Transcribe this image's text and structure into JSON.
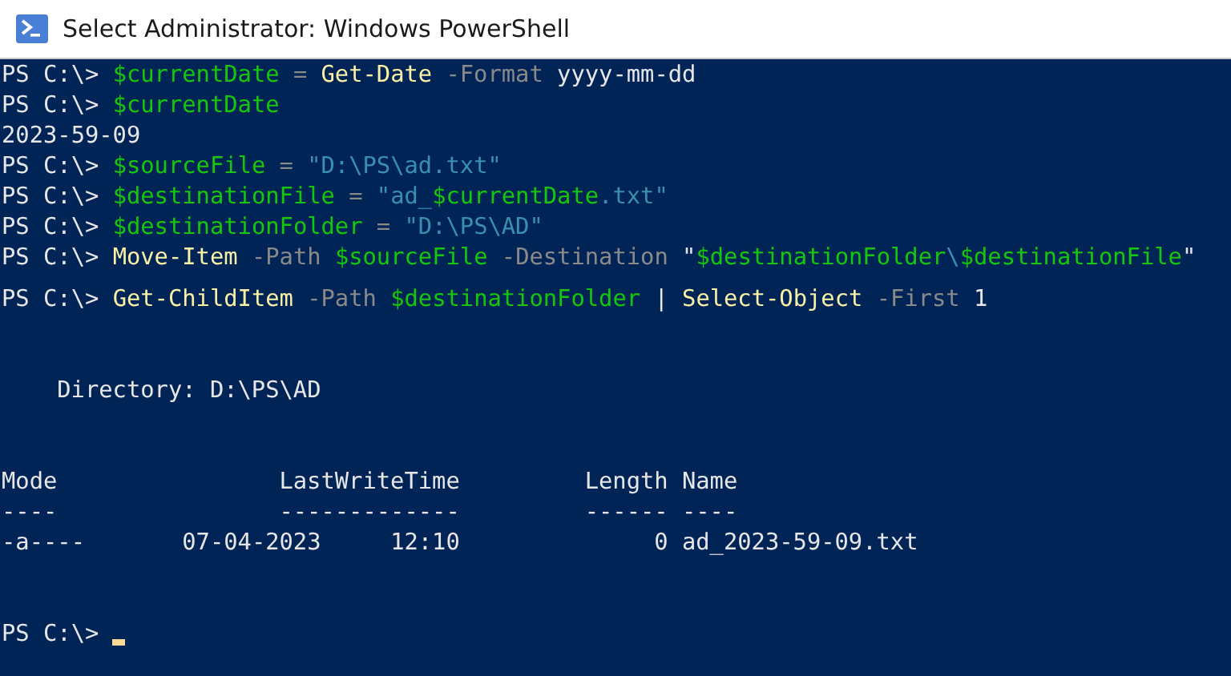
{
  "window": {
    "title": "Select Administrator: Windows PowerShell"
  },
  "console": {
    "lines": [
      {
        "tokens": [
          {
            "kind": "prompt",
            "text": "PS C:\\>"
          },
          {
            "kind": "variable",
            "text": "$currentDate"
          },
          {
            "kind": "operator",
            "text": "="
          },
          {
            "kind": "command",
            "text": "Get-Date"
          },
          {
            "kind": "parameter",
            "text": "-Format"
          },
          {
            "kind": "plain",
            "text": "yyyy-mm-dd"
          }
        ]
      },
      {
        "tokens": [
          {
            "kind": "prompt",
            "text": "PS C:\\>"
          },
          {
            "kind": "variable",
            "text": "$currentDate"
          }
        ]
      },
      {
        "tokens": [
          {
            "kind": "plain",
            "text": "2023-59-09"
          }
        ]
      },
      {
        "tokens": [
          {
            "kind": "prompt",
            "text": "PS C:\\>"
          },
          {
            "kind": "variable",
            "text": "$sourceFile"
          },
          {
            "kind": "operator",
            "text": "="
          },
          {
            "kind": "string",
            "text": "\"D:\\PS\\ad.txt\""
          }
        ]
      },
      {
        "tokens": [
          {
            "kind": "prompt",
            "text": "PS C:\\>"
          },
          {
            "kind": "variable",
            "text": "$destinationFile"
          },
          {
            "kind": "operator",
            "text": "="
          },
          {
            "kind": "string",
            "text": "\"ad_"
          },
          {
            "kind": "variable",
            "text": "$currentDate",
            "joined": true
          },
          {
            "kind": "string",
            "text": ".txt\"",
            "joined": true
          }
        ]
      },
      {
        "tokens": [
          {
            "kind": "prompt",
            "text": "PS C:\\>"
          },
          {
            "kind": "variable",
            "text": "$destinationFolder"
          },
          {
            "kind": "operator",
            "text": "="
          },
          {
            "kind": "string",
            "text": "\"D:\\PS\\AD\""
          }
        ]
      },
      {
        "tokens": [
          {
            "kind": "prompt",
            "text": "PS C:\\>"
          },
          {
            "kind": "command",
            "text": "Move-Item"
          },
          {
            "kind": "parameter",
            "text": "-Path"
          },
          {
            "kind": "variable",
            "text": "$sourceFile"
          },
          {
            "kind": "parameter",
            "text": "-Destination"
          },
          {
            "kind": "plain",
            "text": "\""
          },
          {
            "kind": "variable",
            "text": "$destinationFolder",
            "joined": true
          },
          {
            "kind": "string",
            "text": "\\",
            "joined": true
          },
          {
            "kind": "variable",
            "text": "$destinationFile",
            "joined": true
          },
          {
            "kind": "plain",
            "text": "\"",
            "joined": true
          }
        ]
      },
      {
        "tokens": [
          {
            "kind": "prompt",
            "text": "PS C:\\>"
          },
          {
            "kind": "command",
            "text": "Get-ChildItem"
          },
          {
            "kind": "parameter",
            "text": "-Path"
          },
          {
            "kind": "variable",
            "text": "$destinationFolder"
          },
          {
            "kind": "plain",
            "text": "|"
          },
          {
            "kind": "command",
            "text": "Select-Object"
          },
          {
            "kind": "parameter",
            "text": "-First"
          },
          {
            "kind": "plain",
            "text": "1"
          }
        ]
      }
    ],
    "directory": {
      "label": "Directory:",
      "path": "D:\\PS\\AD"
    },
    "table": {
      "columns": [
        "Mode",
        "LastWriteTime",
        "Length",
        "Name"
      ],
      "rules": [
        "----",
        "-------------",
        "------",
        "----"
      ],
      "rows": [
        {
          "mode": "-a----",
          "date": "07-04-2023",
          "time": "12:10",
          "length": "0",
          "name": "ad_2023-59-09.txt"
        }
      ]
    },
    "final_prompt": "PS C:\\>"
  }
}
